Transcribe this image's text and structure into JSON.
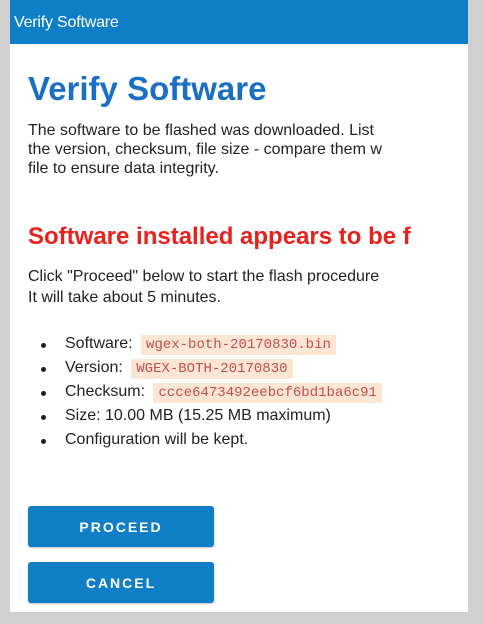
{
  "window": {
    "title": "Verify Software"
  },
  "page": {
    "heading": "Verify Software",
    "description_lines": [
      "The software to be flashed was downloaded. List",
      "the version, checksum, file size - compare them w",
      "file to ensure data integrity."
    ],
    "warning": "Software installed appears to be f",
    "instructions_lines": [
      "Click \"Proceed\" below to start the flash procedure",
      "It will take about 5 minutes."
    ],
    "details": {
      "software_label": "Software:",
      "software_value": "wgex-both-20170830.bin",
      "version_label": "Version:",
      "version_value": "WGEX-BOTH-20170830",
      "checksum_label": "Checksum:",
      "checksum_value": "ccce6473492eebcf6bd1ba6c91",
      "size_text": "Size: 10.00 MB (15.25 MB maximum)",
      "config_text": "Configuration will be kept."
    }
  },
  "buttons": {
    "proceed": "PROCEED",
    "cancel": "CANCEL"
  },
  "colors": {
    "titlebar": "#0e7fc7",
    "heading": "#1a6fc4",
    "warning": "#e8211c",
    "code_bg": "#fbe5d3",
    "code_text": "#c0504d",
    "button": "#0e7fc7"
  }
}
